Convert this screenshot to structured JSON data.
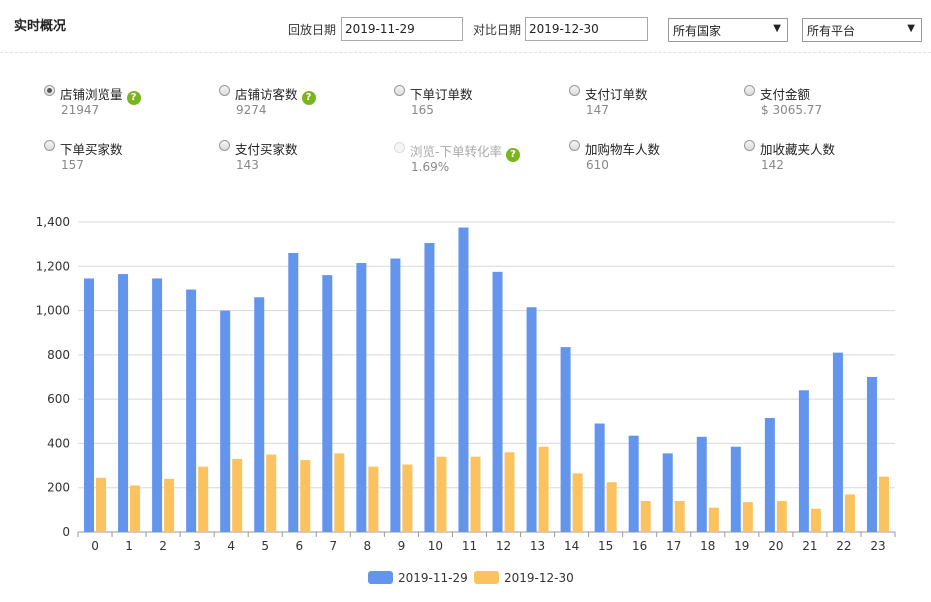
{
  "page": {
    "title": "实时概况"
  },
  "toolbar": {
    "replay_label": "回放日期",
    "replay_value": "2019-11-29",
    "compare_label": "对比日期",
    "compare_value": "2019-12-30",
    "country_select": "所有国家",
    "platform_select": "所有平台"
  },
  "metrics": [
    {
      "label": "店铺浏览量",
      "value": "21947",
      "checked": true,
      "help": true
    },
    {
      "label": "店铺访客数",
      "value": "9274",
      "help": true
    },
    {
      "label": "下单订单数",
      "value": "165"
    },
    {
      "label": "支付订单数",
      "value": "147"
    },
    {
      "label": "支付金额",
      "value": "$ 3065.77"
    },
    {
      "label": "下单买家数",
      "value": "157"
    },
    {
      "label": "支付买家数",
      "value": "143"
    },
    {
      "label": "浏览-下单转化率",
      "value": "1.69%",
      "disabled": true,
      "help": true
    },
    {
      "label": "加购物车人数",
      "value": "610"
    },
    {
      "label": "加收藏夹人数",
      "value": "142"
    }
  ],
  "colors": {
    "series1": "#6495ed",
    "series2": "#fbc35f",
    "help": "#7ab51d",
    "grid": "#d8d8d8"
  },
  "chart_data": {
    "type": "bar",
    "categories": [
      "0",
      "1",
      "2",
      "3",
      "4",
      "5",
      "6",
      "7",
      "8",
      "9",
      "10",
      "11",
      "12",
      "13",
      "14",
      "15",
      "16",
      "17",
      "18",
      "19",
      "20",
      "21",
      "22",
      "23"
    ],
    "series": [
      {
        "name": "2019-11-29",
        "values": [
          1145,
          1165,
          1145,
          1095,
          1000,
          1060,
          1260,
          1160,
          1215,
          1235,
          1305,
          1375,
          1175,
          1015,
          835,
          490,
          435,
          355,
          430,
          385,
          515,
          640,
          810,
          700
        ]
      },
      {
        "name": "2019-12-30",
        "values": [
          245,
          210,
          240,
          295,
          330,
          350,
          325,
          355,
          295,
          305,
          340,
          340,
          360,
          385,
          265,
          225,
          140,
          140,
          110,
          135,
          140,
          105,
          170,
          250
        ]
      }
    ],
    "yticks": [
      0,
      200,
      400,
      600,
      800,
      1000,
      1200,
      1400
    ],
    "yticklabels": [
      "0",
      "200",
      "400",
      "600",
      "800",
      "1,000",
      "1,200",
      "1,400"
    ],
    "ylim": [
      0,
      1400
    ],
    "grid": true,
    "legend": "bottom"
  }
}
